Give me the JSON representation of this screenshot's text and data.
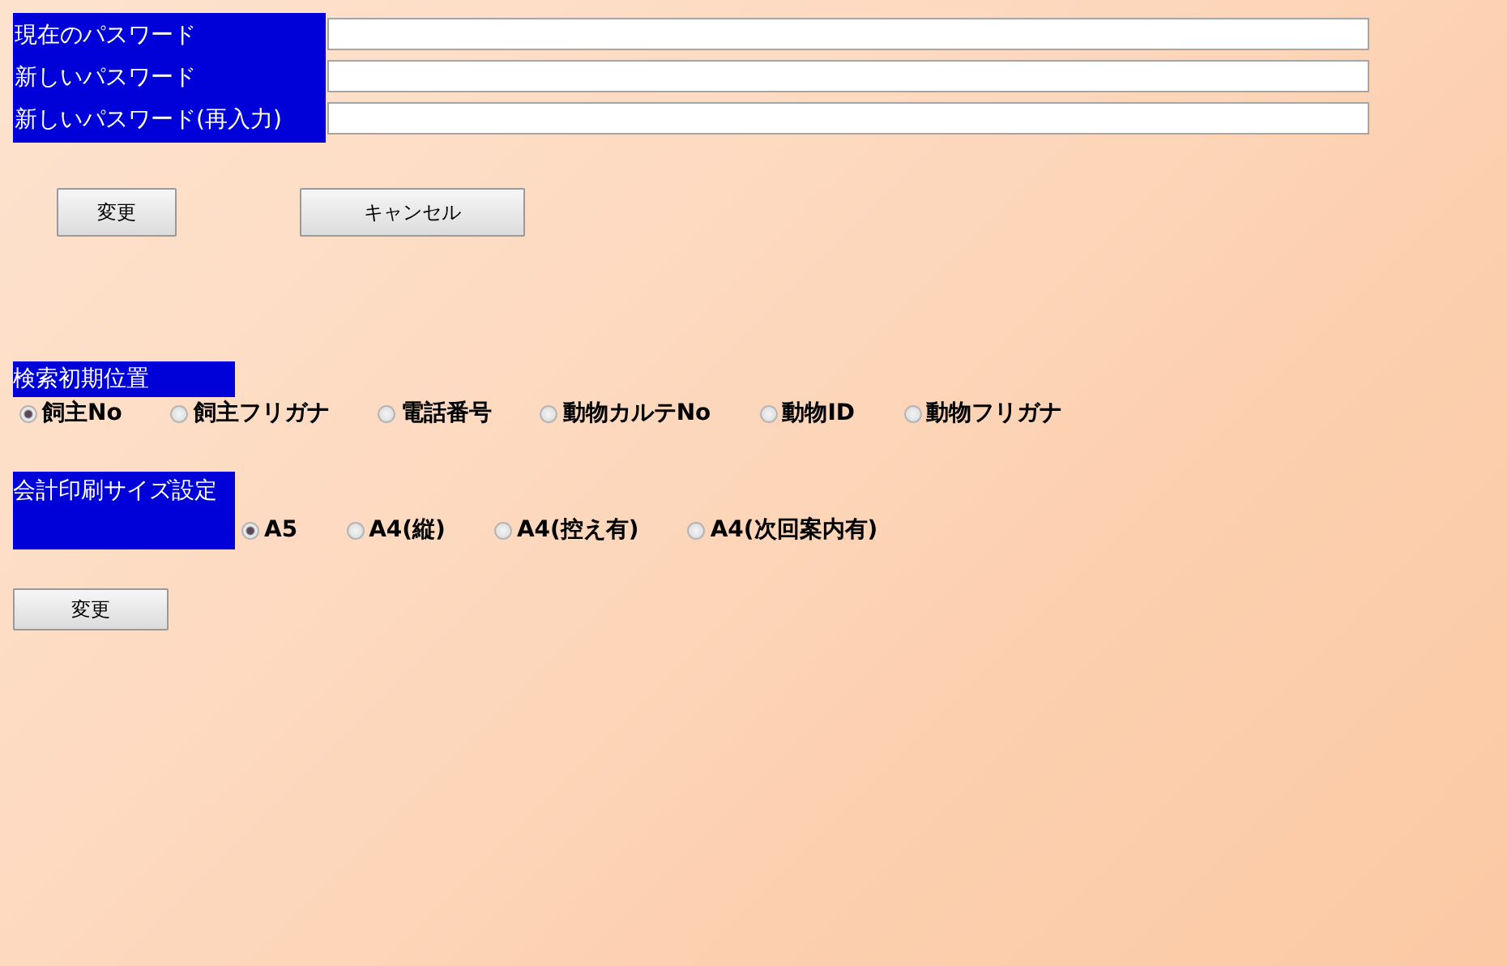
{
  "password_fields": [
    {
      "label": "現在のパスワード"
    },
    {
      "label": "新しいパスワード"
    },
    {
      "label": "新しいパスワード(再入力)"
    }
  ],
  "password_buttons": [
    {
      "label": "変更",
      "kind": "change"
    },
    {
      "label": "キャンセル",
      "kind": "cancel"
    }
  ],
  "search_initial_position": {
    "label": "検索初期位置",
    "options": [
      {
        "label": "飼主No",
        "selected": true
      },
      {
        "label": "飼主フリガナ",
        "selected": false
      },
      {
        "label": "電話番号",
        "selected": false
      },
      {
        "label": "動物カルテNo",
        "selected": false
      },
      {
        "label": "動物ID",
        "selected": false
      },
      {
        "label": "動物フリガナ",
        "selected": false
      }
    ]
  },
  "print_size": {
    "label": "会計印刷サイズ設定",
    "options": [
      {
        "label": "A5",
        "selected": true
      },
      {
        "label": "A4(縦)",
        "selected": false
      },
      {
        "label": "A4(控え有)",
        "selected": false
      },
      {
        "label": "A4(次回案内有)",
        "selected": false
      }
    ]
  },
  "save_button": {
    "label": "変更"
  }
}
